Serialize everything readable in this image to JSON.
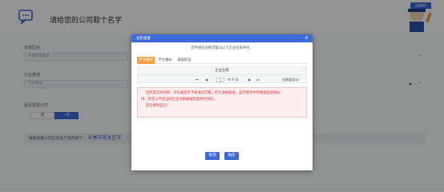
{
  "page": {
    "title": "请给您的公司取个名字",
    "mascot_badge": "主要提问",
    "region": {
      "label": "名称区划",
      "value": "长春市南关区"
    },
    "industry": {
      "label": "行业表述",
      "value": "汽车租赁"
    },
    "branch": {
      "label": "是否集团公司",
      "options": [
        "否",
        "✓否"
      ]
    },
    "hint": {
      "text": "根据您输入的信息生产名称如下：",
      "highlight": "长春市南关区字"
    }
  },
  "modal": {
    "title": "名称查重",
    "close": "×",
    "subtitle": "您申请的名称可能与以下企业名称冲突。",
    "tabs": [
      "字号相近",
      "字号相似",
      "表现形近"
    ],
    "table_header": "企业名称",
    "pager": {
      "first": "⏮",
      "prev": "◀",
      "page": "1",
      "total": "共 0 页",
      "next": "▶",
      "last": "⏭",
      "empty": "无数据显示"
    },
    "warning_lines": [
      "您所提交的名称，存在被驳不予核准的可能，存在虚假核准，虽然使用中可能面临侵权纠",
      "纷，甚至以不适当的企业名称被强制变更的风险。",
      "是否继续提交？"
    ],
    "buttons": {
      "cancel": "取消",
      "confirm": "确定"
    }
  },
  "colors": {
    "accent": "#3d6ad6",
    "tab_active": "#f5a043",
    "warning": "#e0303a"
  }
}
